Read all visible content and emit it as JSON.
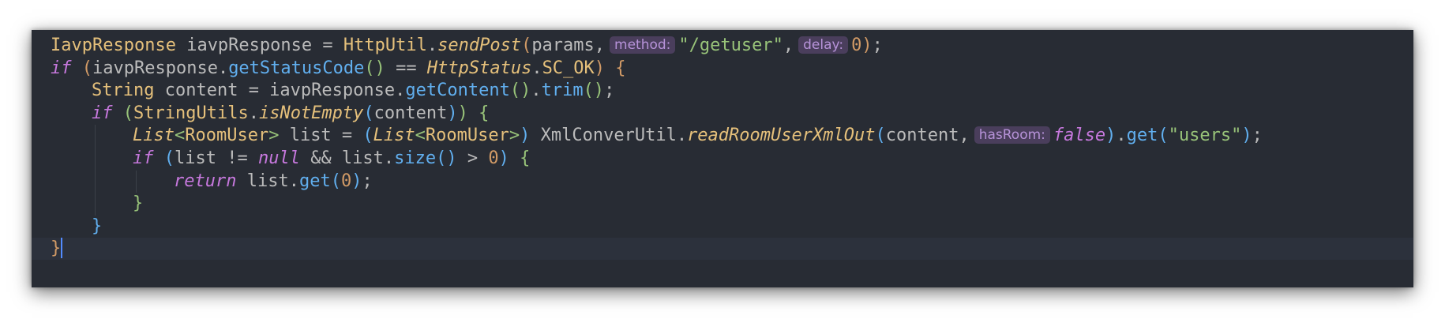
{
  "colors": {
    "background": "#282c34",
    "default": "#bbbbbb",
    "keyword": "#c678dd",
    "type": "#e5c07b",
    "method": "#61afef",
    "static_method": "#e5c07b",
    "string": "#98c379",
    "number": "#d19a66",
    "bracket_gold": "#d19a66",
    "bracket_green": "#98c379",
    "bracket_blue": "#61afef",
    "hint_bg": "#4a3e5c",
    "hint_fg": "#b793d9"
  },
  "editor": {
    "lines": [
      {
        "indent": 0,
        "tokens": [
          {
            "t": "IavpResponse",
            "c": "type"
          },
          {
            "t": " iavpResponse = ",
            "c": "default"
          },
          {
            "t": "HttpUtil",
            "c": "type"
          },
          {
            "t": ".",
            "c": "default"
          },
          {
            "t": "sendPost",
            "c": "static_method",
            "i": true
          },
          {
            "t": "(",
            "c": "bracket_gold"
          },
          {
            "t": "params,",
            "c": "default"
          },
          {
            "h": "method:"
          },
          {
            "t": "\"/getuser\"",
            "c": "string"
          },
          {
            "t": ",",
            "c": "default"
          },
          {
            "h": "delay:"
          },
          {
            "t": "0",
            "c": "number"
          },
          {
            "t": ")",
            "c": "bracket_gold"
          },
          {
            "t": ";",
            "c": "default"
          }
        ]
      },
      {
        "indent": 0,
        "tokens": [
          {
            "t": "if",
            "c": "keyword",
            "i": true
          },
          {
            "t": " ",
            "c": "default"
          },
          {
            "t": "(",
            "c": "bracket_gold"
          },
          {
            "t": "iavpResponse.",
            "c": "default"
          },
          {
            "t": "getStatusCode",
            "c": "method"
          },
          {
            "t": "()",
            "c": "bracket_green"
          },
          {
            "t": " == ",
            "c": "default"
          },
          {
            "t": "HttpStatus",
            "c": "type",
            "i": true
          },
          {
            "t": ".",
            "c": "default"
          },
          {
            "t": "SC_OK",
            "c": "type"
          },
          {
            "t": ")",
            "c": "bracket_gold"
          },
          {
            "t": " ",
            "c": "default"
          },
          {
            "t": "{",
            "c": "bracket_gold"
          }
        ]
      },
      {
        "indent": 1,
        "tokens": [
          {
            "t": "String",
            "c": "type"
          },
          {
            "t": " content = iavpResponse.",
            "c": "default"
          },
          {
            "t": "getContent",
            "c": "method"
          },
          {
            "t": "()",
            "c": "bracket_green"
          },
          {
            "t": ".",
            "c": "default"
          },
          {
            "t": "trim",
            "c": "method"
          },
          {
            "t": "()",
            "c": "bracket_green"
          },
          {
            "t": ";",
            "c": "default"
          }
        ]
      },
      {
        "indent": 1,
        "tokens": [
          {
            "t": "if",
            "c": "keyword",
            "i": true
          },
          {
            "t": " ",
            "c": "default"
          },
          {
            "t": "(",
            "c": "bracket_green"
          },
          {
            "t": "StringUtils",
            "c": "type"
          },
          {
            "t": ".",
            "c": "default"
          },
          {
            "t": "isNotEmpty",
            "c": "static_method",
            "i": true
          },
          {
            "t": "(",
            "c": "bracket_blue"
          },
          {
            "t": "content",
            "c": "default"
          },
          {
            "t": ")",
            "c": "bracket_blue"
          },
          {
            "t": ")",
            "c": "bracket_green"
          },
          {
            "t": " ",
            "c": "default"
          },
          {
            "t": "{",
            "c": "bracket_green"
          }
        ]
      },
      {
        "indent": 2,
        "tokens": [
          {
            "t": "List",
            "c": "type",
            "i": true
          },
          {
            "t": "<",
            "c": "bracket_green"
          },
          {
            "t": "RoomUser",
            "c": "type"
          },
          {
            "t": ">",
            "c": "bracket_green"
          },
          {
            "t": " list = ",
            "c": "default"
          },
          {
            "t": "(",
            "c": "bracket_blue"
          },
          {
            "t": "List",
            "c": "type",
            "i": true
          },
          {
            "t": "<",
            "c": "bracket_green"
          },
          {
            "t": "RoomUser",
            "c": "type"
          },
          {
            "t": ">",
            "c": "bracket_green"
          },
          {
            "t": ")",
            "c": "bracket_blue"
          },
          {
            "t": " ",
            "c": "default"
          },
          {
            "t": "XmlConverUtil",
            "c": "default"
          },
          {
            "t": ".",
            "c": "default"
          },
          {
            "t": "readRoomUserXmlOut",
            "c": "static_method",
            "i": true
          },
          {
            "t": "(",
            "c": "bracket_blue"
          },
          {
            "t": "content,",
            "c": "default"
          },
          {
            "h": "hasRoom:"
          },
          {
            "t": "false",
            "c": "keyword",
            "i": true
          },
          {
            "t": ")",
            "c": "bracket_blue"
          },
          {
            "t": ".",
            "c": "default"
          },
          {
            "t": "get",
            "c": "method"
          },
          {
            "t": "(",
            "c": "bracket_blue"
          },
          {
            "t": "\"users\"",
            "c": "string"
          },
          {
            "t": ")",
            "c": "bracket_blue"
          },
          {
            "t": ";",
            "c": "default"
          }
        ]
      },
      {
        "indent": 2,
        "tokens": [
          {
            "t": "if",
            "c": "keyword",
            "i": true
          },
          {
            "t": " ",
            "c": "default"
          },
          {
            "t": "(",
            "c": "bracket_blue"
          },
          {
            "t": "list != ",
            "c": "default"
          },
          {
            "t": "null",
            "c": "keyword",
            "i": true
          },
          {
            "t": " && list.",
            "c": "default"
          },
          {
            "t": "size",
            "c": "method"
          },
          {
            "t": "()",
            "c": "bracket_blue"
          },
          {
            "t": " > ",
            "c": "default"
          },
          {
            "t": "0",
            "c": "number"
          },
          {
            "t": ")",
            "c": "bracket_blue"
          },
          {
            "t": " ",
            "c": "default"
          },
          {
            "t": "{",
            "c": "bracket_green"
          }
        ]
      },
      {
        "indent": 3,
        "tokens": [
          {
            "t": "return",
            "c": "keyword",
            "i": true
          },
          {
            "t": " list.",
            "c": "default"
          },
          {
            "t": "get",
            "c": "method"
          },
          {
            "t": "(",
            "c": "bracket_blue"
          },
          {
            "t": "0",
            "c": "number"
          },
          {
            "t": ")",
            "c": "bracket_blue"
          },
          {
            "t": ";",
            "c": "default"
          }
        ]
      },
      {
        "indent": 2,
        "tokens": [
          {
            "t": "}",
            "c": "bracket_green"
          }
        ]
      },
      {
        "indent": 1,
        "tokens": [
          {
            "t": "}",
            "c": "bracket_blue"
          }
        ]
      },
      {
        "indent": 0,
        "caret_after": true,
        "tokens": [
          {
            "t": "}",
            "c": "bracket_gold"
          }
        ]
      }
    ]
  }
}
